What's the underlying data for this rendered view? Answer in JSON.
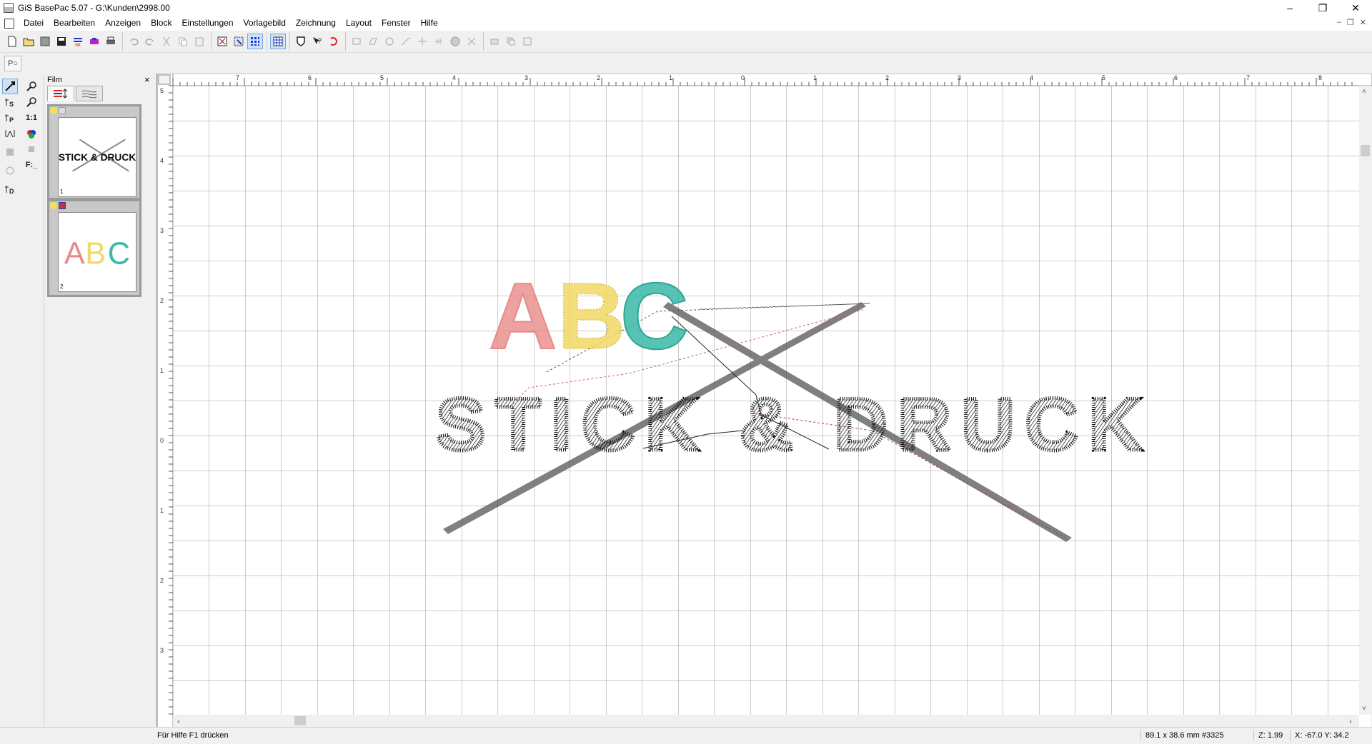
{
  "window": {
    "title": "GiS BasePac 5.07 - G:\\Kunden\\2998.00",
    "minimize": "–",
    "restore": "❐",
    "close": "✕"
  },
  "menu": {
    "items": [
      "Datei",
      "Bearbeiten",
      "Anzeigen",
      "Block",
      "Einstellungen",
      "Vorlagebild",
      "Zeichnung",
      "Layout",
      "Fenster",
      "Hilfe"
    ],
    "mdi_min": "–",
    "mdi_restore": "❐",
    "mdi_close": "✕"
  },
  "toolbar2": {
    "pointer_label": "P○"
  },
  "left_tools": {
    "one_to_one": "1:1",
    "font_tool": "F:_"
  },
  "film": {
    "title": "Film",
    "close": "×",
    "thumbs": [
      {
        "number": "1",
        "text": "STICK & DRUCK"
      },
      {
        "number": "2",
        "text": "ABC"
      }
    ]
  },
  "design": {
    "letters": [
      {
        "char": "A",
        "color": "#e88a8a"
      },
      {
        "char": "B",
        "color": "#f2d864"
      },
      {
        "char": "C",
        "color": "#3bb8a8"
      }
    ],
    "main_text": "STICK & DRUCK",
    "stitch_color": "#1a1a1a"
  },
  "ruler": {
    "top_labels": [
      "7",
      "6",
      "5",
      "4",
      "3",
      "2",
      "1",
      "0",
      "1",
      "2",
      "3",
      "4",
      "5",
      "6",
      "7",
      "8"
    ],
    "left_labels": [
      "5",
      "4",
      "3",
      "2",
      "1",
      "0",
      "1",
      "2",
      "3"
    ]
  },
  "status": {
    "help": "Für Hilfe F1 drücken",
    "size": "89.1 x 38.6 mm #3325",
    "zoom": "Z:  1.99",
    "coords": "X: -67.0  Y: 34.2"
  }
}
